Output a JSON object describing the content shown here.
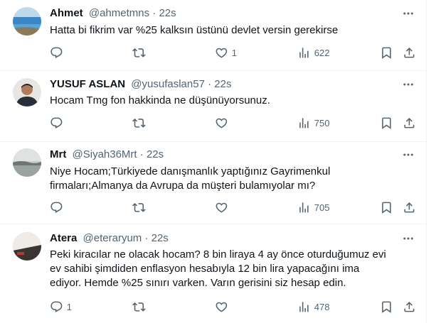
{
  "tweets": [
    {
      "name": "Ahmet",
      "handle": "@ahmetmns",
      "dot": "·",
      "time": "22s",
      "text": "Hatta bi fikrim var %25 kalksın üstünü devlet versin gerekirse",
      "reply_count": "",
      "retweet_count": "",
      "like_count": "1",
      "view_count": "622",
      "avatar": "sea-landscape"
    },
    {
      "name": "YUSUF ASLAN",
      "handle": "@yusufaslan57",
      "dot": "·",
      "time": "22s",
      "text": "Hocam Tmg fon hakkinda ne düşünüyorsunuz.",
      "reply_count": "",
      "retweet_count": "",
      "like_count": "",
      "view_count": "750",
      "avatar": "person-portrait"
    },
    {
      "name": "Mrt",
      "handle": "@Siyah36Mrt",
      "dot": "·",
      "time": "22s",
      "text": "Niye Hocam;Türkiyede danışmanlık yaptığınız Gayrimenkul firmaları;Almanya da Avrupa da müşteri bulamıyolar mı?",
      "reply_count": "",
      "retweet_count": "",
      "like_count": "",
      "view_count": "705",
      "avatar": "misty-lake"
    },
    {
      "name": "Atera",
      "handle": "@eteraryum",
      "dot": "·",
      "time": "22s",
      "text": "Peki kiracılar ne olacak hocam? 8 bin liraya 4 ay önce oturduğumuz evi ev sahibi şimdiden enflasyon hesabıyla 12 bin lira yapacağını ima ediyor. Hemde %25 sınırı varken. Varın gerisini siz hesap edin.",
      "reply_count": "1",
      "retweet_count": "",
      "like_count": "",
      "view_count": "478",
      "avatar": "dark-room"
    }
  ]
}
